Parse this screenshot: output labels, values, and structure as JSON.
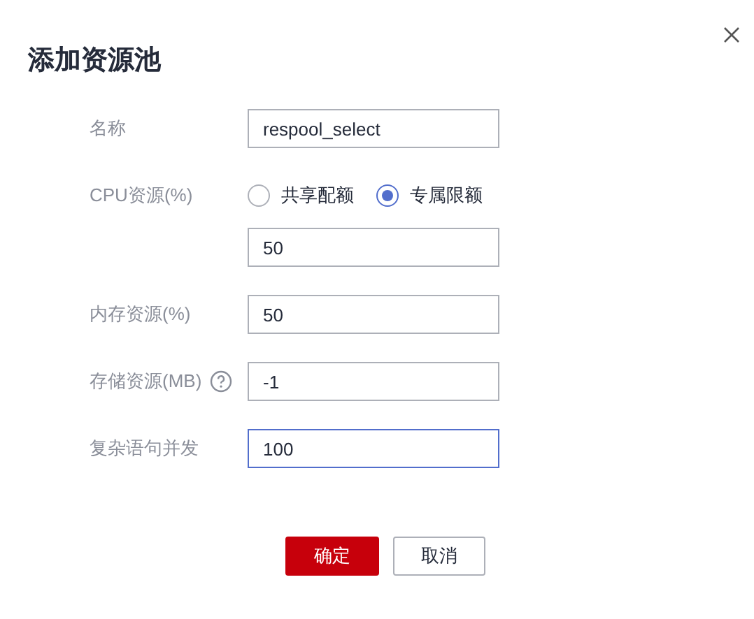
{
  "dialog": {
    "title": "添加资源池"
  },
  "fields": [
    {
      "kind": "text",
      "label": "名称",
      "value": "respool_select",
      "focused": false
    },
    {
      "kind": "radio",
      "label": "CPU资源(%)",
      "options": [
        {
          "label": "共享配额",
          "selected": false
        },
        {
          "label": "专属限额",
          "selected": true
        }
      ]
    },
    {
      "kind": "text",
      "value": "50",
      "focused": false
    },
    {
      "kind": "text",
      "label": "内存资源(%)",
      "value": "50",
      "focused": false
    },
    {
      "kind": "text",
      "label": "存储资源(MB)",
      "help": true,
      "value": "-1",
      "focused": false
    },
    {
      "kind": "text",
      "label": "复杂语句并发",
      "value": "100",
      "focused": true
    }
  ],
  "buttons": [
    {
      "label": "确定",
      "primary": true
    },
    {
      "label": "取消",
      "primary": false
    }
  ]
}
